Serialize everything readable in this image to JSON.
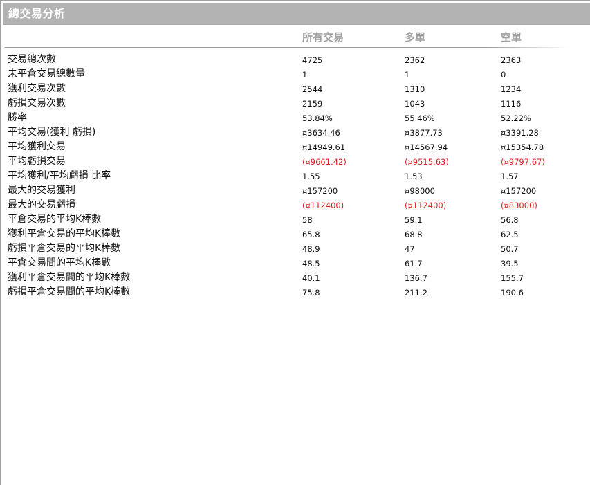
{
  "panel": {
    "title": "總交易分析"
  },
  "columns": [
    "所有交易",
    "多單",
    "空單"
  ],
  "rows": [
    {
      "label": "交易總次數",
      "values": [
        "4725",
        "2362",
        "2363"
      ],
      "negative": [
        false,
        false,
        false
      ]
    },
    {
      "label": "未平倉交易總數量",
      "values": [
        "1",
        "1",
        "0"
      ],
      "negative": [
        false,
        false,
        false
      ]
    },
    {
      "label": "獲利交易次數",
      "values": [
        "2544",
        "1310",
        "1234"
      ],
      "negative": [
        false,
        false,
        false
      ]
    },
    {
      "label": "虧損交易次數",
      "values": [
        "2159",
        "1043",
        "1116"
      ],
      "negative": [
        false,
        false,
        false
      ]
    },
    {
      "label": "勝率",
      "values": [
        "53.84%",
        "55.46%",
        "52.22%"
      ],
      "negative": [
        false,
        false,
        false
      ]
    },
    {
      "label": "平均交易(獲利  虧損)",
      "values": [
        "¤3634.46",
        "¤3877.73",
        "¤3391.28"
      ],
      "negative": [
        false,
        false,
        false
      ]
    },
    {
      "label": "平均獲利交易",
      "values": [
        "¤14949.61",
        "¤14567.94",
        "¤15354.78"
      ],
      "negative": [
        false,
        false,
        false
      ]
    },
    {
      "label": "平均虧損交易",
      "values": [
        "(¤9661.42)",
        "(¤9515.63)",
        "(¤9797.67)"
      ],
      "negative": [
        true,
        true,
        true
      ]
    },
    {
      "label": "平均獲利/平均虧損  比率",
      "values": [
        "1.55",
        "1.53",
        "1.57"
      ],
      "negative": [
        false,
        false,
        false
      ]
    },
    {
      "label": "最大的交易獲利",
      "values": [
        "¤157200",
        "¤98000",
        "¤157200"
      ],
      "negative": [
        false,
        false,
        false
      ]
    },
    {
      "label": "最大的交易虧損",
      "values": [
        "(¤112400)",
        "(¤112400)",
        "(¤83000)"
      ],
      "negative": [
        true,
        true,
        true
      ]
    },
    {
      "label": "平倉交易的平均K棒數",
      "values": [
        "58",
        "59.1",
        "56.8"
      ],
      "negative": [
        false,
        false,
        false
      ]
    },
    {
      "label": "獲利平倉交易的平均K棒數",
      "values": [
        "65.8",
        "68.8",
        "62.5"
      ],
      "negative": [
        false,
        false,
        false
      ]
    },
    {
      "label": "虧損平倉交易的平均K棒數",
      "values": [
        "48.9",
        "47",
        "50.7"
      ],
      "negative": [
        false,
        false,
        false
      ]
    },
    {
      "label": "平倉交易間的平均K棒數",
      "values": [
        "48.5",
        "61.7",
        "39.5"
      ],
      "negative": [
        false,
        false,
        false
      ]
    },
    {
      "label": "獲利平倉交易間的平均K棒數",
      "values": [
        "40.1",
        "136.7",
        "155.7"
      ],
      "negative": [
        false,
        false,
        false
      ]
    },
    {
      "label": "虧損平倉交易間的平均K棒數",
      "values": [
        "75.8",
        "211.2",
        "190.6"
      ],
      "negative": [
        false,
        false,
        false
      ]
    }
  ],
  "colors": {
    "title_bar": "#b3b3b3",
    "title_text": "#ffffff",
    "header_text": "#a0a0a0",
    "negative_value": "#e02020"
  }
}
